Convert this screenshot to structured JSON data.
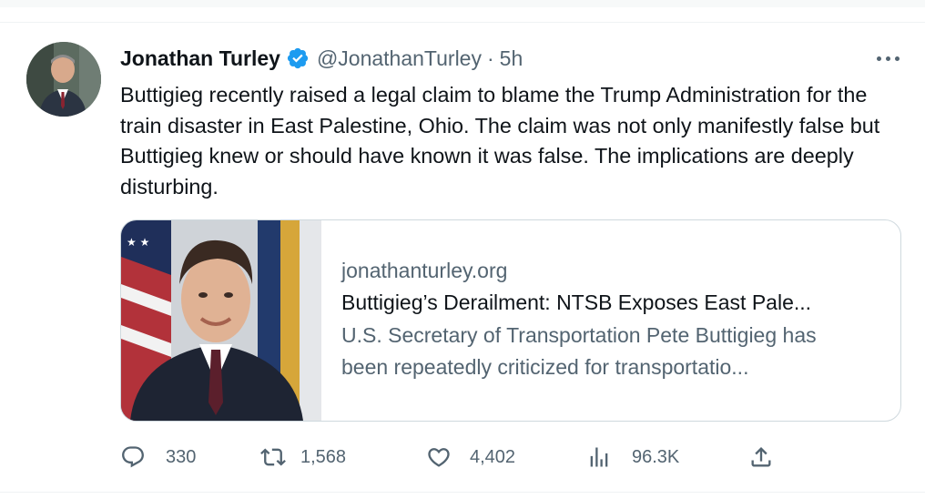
{
  "tweet": {
    "author_name": "Jonathan Turley",
    "handle": "@JonathanTurley",
    "separator": "·",
    "time": "5h",
    "text": "Buttigieg recently raised a legal claim to blame the Trump Administration for the train disaster in East Palestine, Ohio. The claim was not only manifestly false but Buttigieg knew or should have known it was false. The implications are deeply disturbing.",
    "avatar_icon": "user-avatar",
    "verified_icon": "verified-badge-icon",
    "more_icon": "more-options-icon"
  },
  "card": {
    "domain": "jonathanturley.org",
    "title": "Buttigieg’s Derailment: NTSB Exposes East Pale...",
    "description": "U.S. Secretary of Transportation Pete Buttigieg has been repeatedly criticized for transportatio..."
  },
  "actions": {
    "replies": {
      "icon": "reply-icon",
      "count": "330"
    },
    "retweets": {
      "icon": "retweet-icon",
      "count": "1,568"
    },
    "likes": {
      "icon": "heart-icon",
      "count": "4,402"
    },
    "views": {
      "icon": "views-icon",
      "count": "96.3K"
    },
    "share": {
      "icon": "share-icon"
    }
  },
  "colors": {
    "primary_text": "#0f1419",
    "secondary_text": "#536471",
    "verified_blue": "#1d9bf0",
    "border": "#cfd9de"
  }
}
